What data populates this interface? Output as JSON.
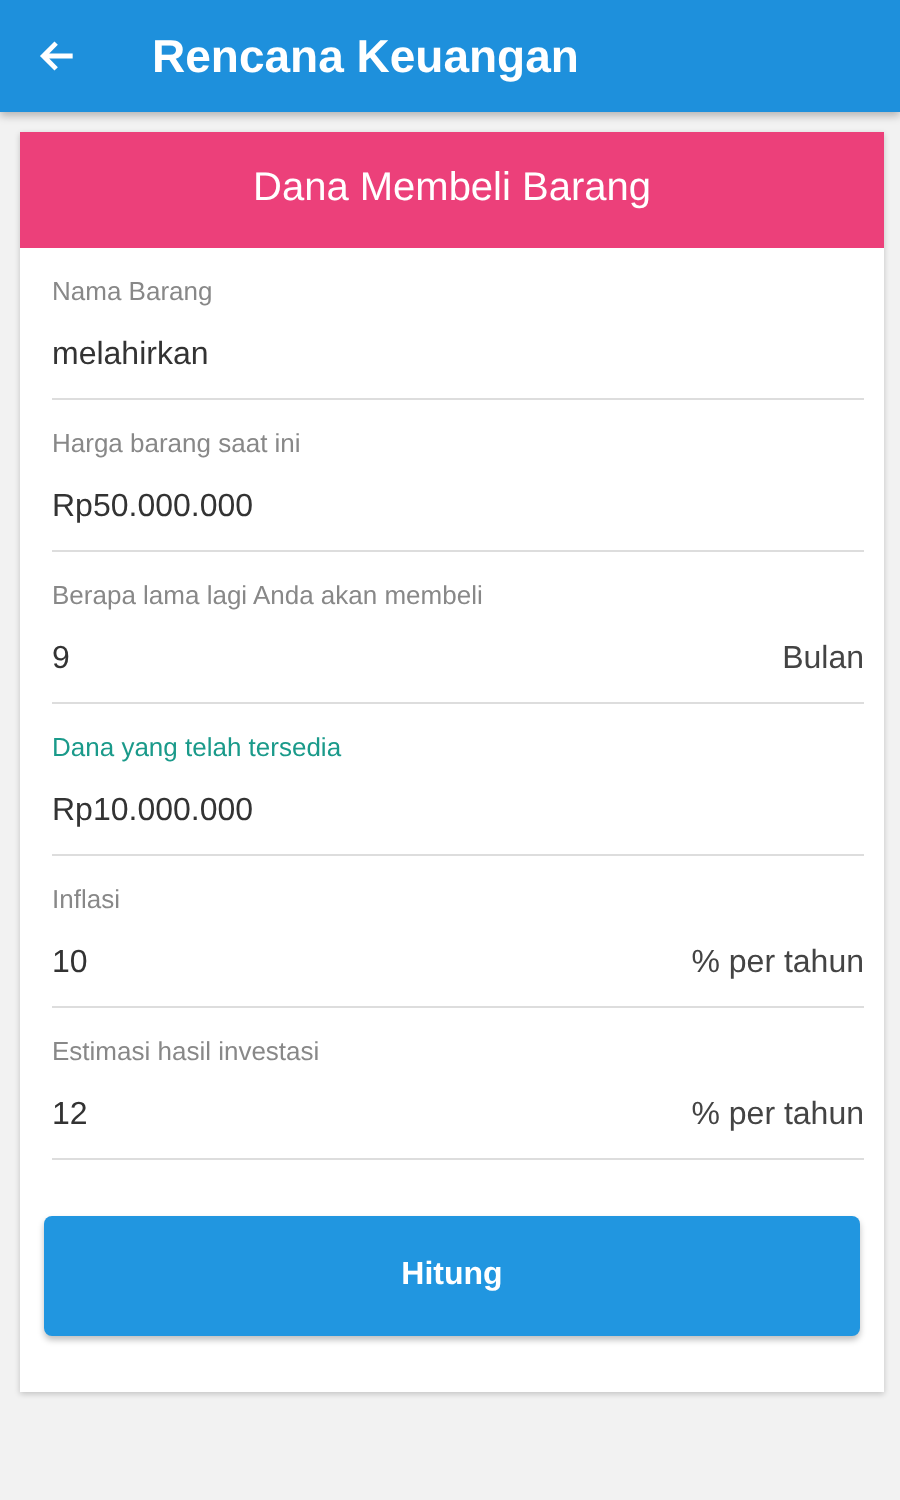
{
  "app_bar": {
    "title": "Rencana Keuangan"
  },
  "card": {
    "title": "Dana Membeli Barang",
    "fields": [
      {
        "label": "Nama Barang",
        "value": "melahirkan",
        "focused": false
      },
      {
        "label": "Harga barang saat ini",
        "value": "Rp50.000.000",
        "focused": false
      },
      {
        "label": "Berapa lama lagi Anda akan membeli",
        "value": "9",
        "suffix": "Bulan",
        "focused": false
      },
      {
        "label": "Dana yang telah tersedia",
        "value": "Rp10.000.000",
        "focused": true
      },
      {
        "label": "Inflasi",
        "value": "10",
        "suffix": "% per tahun",
        "focused": false
      },
      {
        "label": "Estimasi hasil investasi",
        "value": "12",
        "suffix": "% per tahun",
        "focused": false
      }
    ]
  },
  "button": {
    "label": "Hitung"
  }
}
